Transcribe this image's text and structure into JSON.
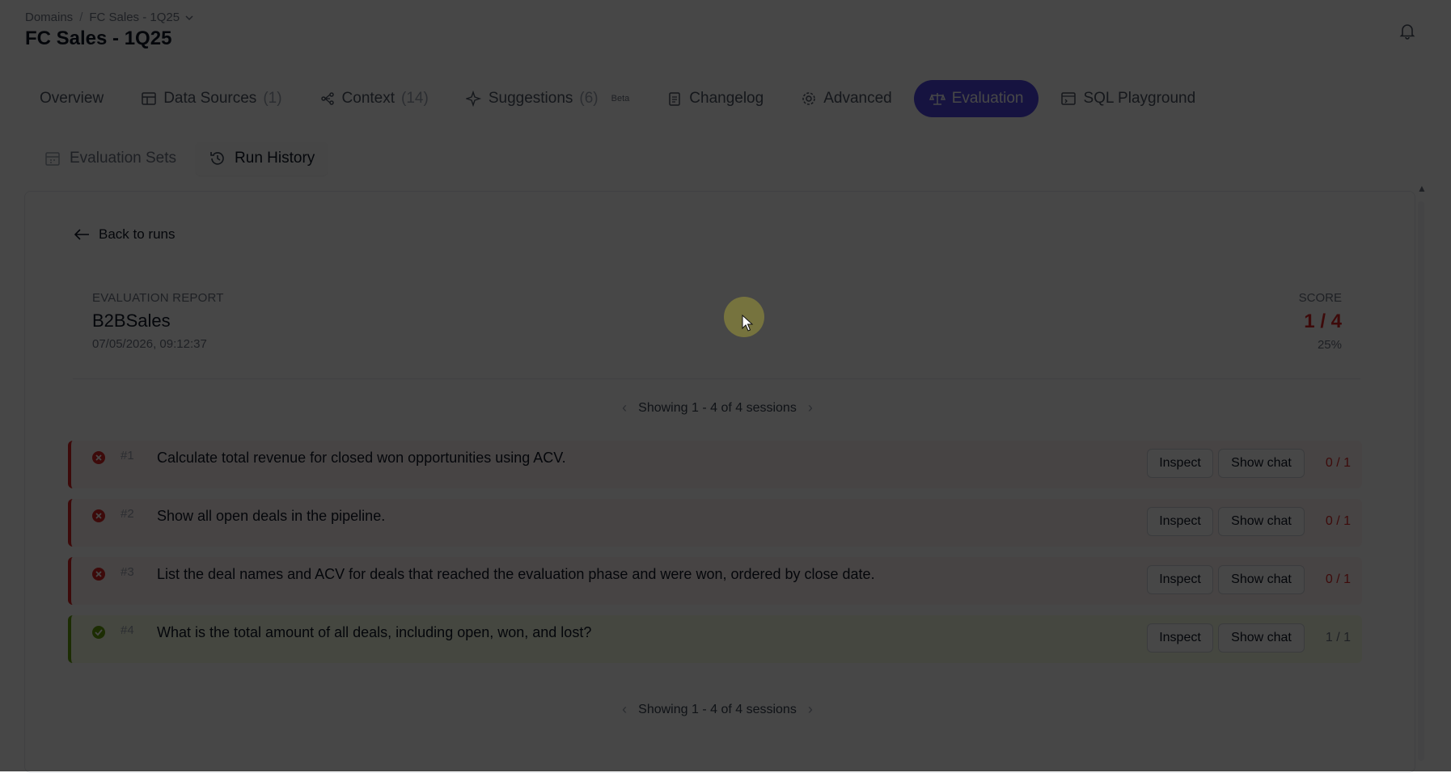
{
  "breadcrumb": {
    "root": "Domains",
    "current": "FC Sales - 1Q25"
  },
  "page_title": "FC Sales - 1Q25",
  "tabs": [
    {
      "label": "Overview",
      "count": ""
    },
    {
      "label": "Data Sources",
      "count": "(1)"
    },
    {
      "label": "Context",
      "count": "(14)"
    },
    {
      "label": "Suggestions",
      "count": "(6)",
      "badge": "Beta"
    },
    {
      "label": "Changelog",
      "count": ""
    },
    {
      "label": "Advanced",
      "count": ""
    },
    {
      "label": "Evaluation",
      "count": "",
      "active": true
    },
    {
      "label": "SQL Playground",
      "count": ""
    }
  ],
  "subtabs": [
    {
      "label": "Evaluation Sets"
    },
    {
      "label": "Run History",
      "active": true
    }
  ],
  "back_label": "Back to runs",
  "report": {
    "label": "EVALUATION REPORT",
    "name": "B2BSales",
    "date": "07/05/2026, 09:12:37",
    "score_label": "SCORE",
    "score": "1 / 4",
    "percent": "25%"
  },
  "pager_text": "Showing 1 - 4 of 4 sessions",
  "sessions": [
    {
      "num": "#1",
      "question": "Calculate total revenue for closed won opportunities using ACV.",
      "inspect": "Inspect",
      "show_chat": "Show chat",
      "score": "0 / 1",
      "passed": false
    },
    {
      "num": "#2",
      "question": "Show all open deals in the pipeline.",
      "inspect": "Inspect",
      "show_chat": "Show chat",
      "score": "0 / 1",
      "passed": false
    },
    {
      "num": "#3",
      "question": "List the deal names and ACV for deals that reached the evaluation phase and were won, ordered by close date.",
      "inspect": "Inspect",
      "show_chat": "Show chat",
      "score": "0 / 1",
      "passed": false
    },
    {
      "num": "#4",
      "question": "What is the total amount of all deals, including open, won, and lost?",
      "inspect": "Inspect",
      "show_chat": "Show chat",
      "score": "1 / 1",
      "passed": true
    }
  ],
  "colors": {
    "accent": "#4f46e5",
    "fail": "#dc2626",
    "pass": "#65a30d",
    "overlay": "rgba(0,0,0,0.72)"
  },
  "icons": {
    "bell": "bell-icon",
    "dropdown": "chevron-down-icon",
    "back": "arrow-left-icon",
    "fail": "x-circle-icon",
    "pass": "check-circle-icon"
  }
}
